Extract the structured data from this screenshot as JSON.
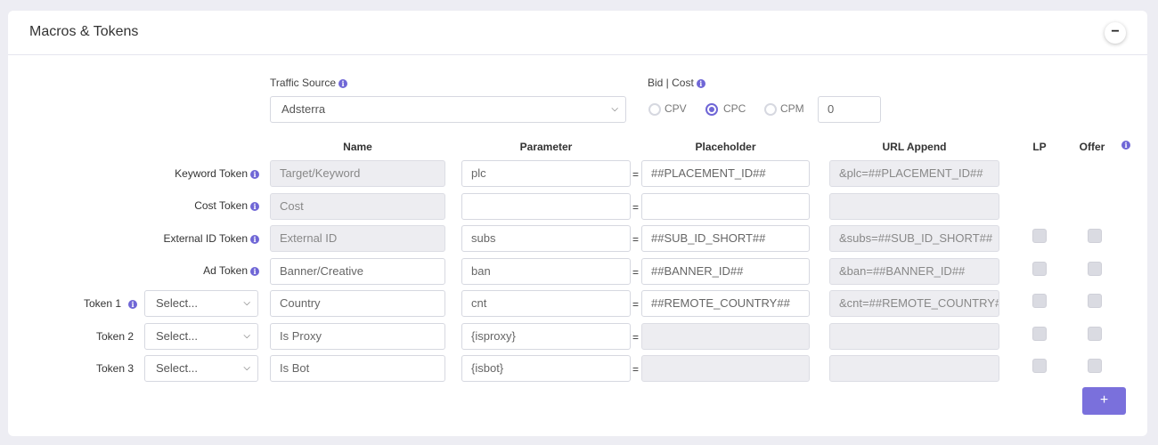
{
  "card": {
    "title": "Macros & Tokens",
    "collapse_label": "−"
  },
  "traffic_source": {
    "label": "Traffic Source",
    "value": "Adsterra"
  },
  "bid_cost": {
    "label": "Bid | Cost",
    "options": [
      "CPV",
      "CPC",
      "CPM"
    ],
    "selected": "CPC",
    "value": "0"
  },
  "columns": {
    "name": "Name",
    "parameter": "Parameter",
    "placeholder": "Placeholder",
    "url_append": "URL Append",
    "lp": "LP",
    "offer": "Offer"
  },
  "rows": [
    {
      "label": "Keyword Token",
      "name": "Target/Keyword",
      "parameter": "plc",
      "placeholder": "##PLACEMENT_ID##",
      "url_append": "&plc=##PLACEMENT_ID##"
    },
    {
      "label": "Cost Token",
      "name": "Cost",
      "parameter": "",
      "placeholder": "",
      "url_append": ""
    },
    {
      "label": "External ID Token",
      "name": "External ID",
      "parameter": "subs",
      "placeholder": "##SUB_ID_SHORT##",
      "url_append": "&subs=##SUB_ID_SHORT##"
    },
    {
      "label": "Ad Token",
      "name": "Banner/Creative",
      "parameter": "ban",
      "placeholder": "##BANNER_ID##",
      "url_append": "&ban=##BANNER_ID##"
    },
    {
      "label": "Token 1",
      "select": "Select...",
      "name": "Country",
      "parameter": "cnt",
      "placeholder": "##REMOTE_COUNTRY##",
      "url_append": "&cnt=##REMOTE_COUNTRY##"
    },
    {
      "label": "Token 2",
      "select": "Select...",
      "name": "Is Proxy",
      "parameter": "{isproxy}",
      "placeholder": "",
      "url_append": ""
    },
    {
      "label": "Token 3",
      "select": "Select...",
      "name": "Is Bot",
      "parameter": "{isbot}",
      "placeholder": "",
      "url_append": ""
    }
  ],
  "equals_sign": "=",
  "add_button_label": "+",
  "colors": {
    "accent": "#6f66d6",
    "button": "#7a70dc",
    "readonly_bg": "#ededf1"
  }
}
